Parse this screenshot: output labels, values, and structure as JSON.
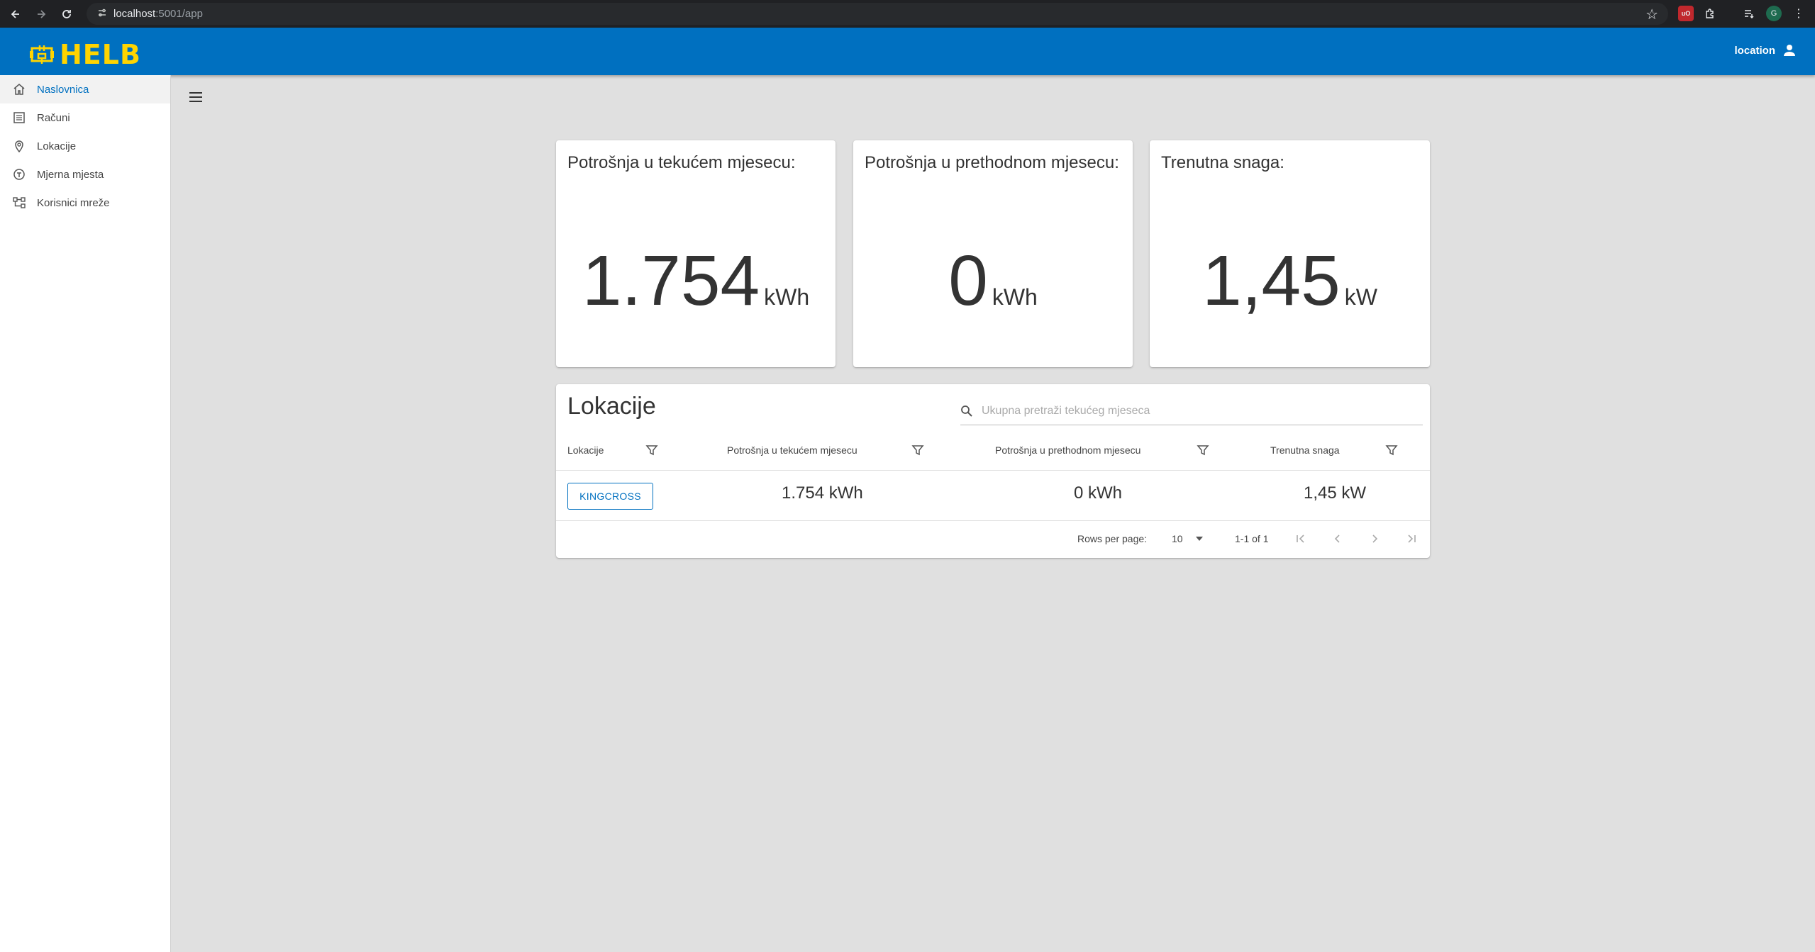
{
  "browser": {
    "url_host": "localhost",
    "url_path": ":5001/app"
  },
  "app": {
    "logo_text": "HELB",
    "user_label": "location"
  },
  "sidebar": {
    "items": [
      {
        "label": "Naslovnica",
        "icon": "home-icon"
      },
      {
        "label": "Računi",
        "icon": "list-icon"
      },
      {
        "label": "Lokacije",
        "icon": "location-pin-icon"
      },
      {
        "label": "Mjerna mjesta",
        "icon": "meter-icon"
      },
      {
        "label": "Korisnici mreže",
        "icon": "network-icon"
      }
    ]
  },
  "stats": [
    {
      "title": "Potrošnja u tekućem mjesecu:",
      "value": "1.754",
      "unit": "kWh"
    },
    {
      "title": "Potrošnja u prethodnom mjesecu:",
      "value": "0",
      "unit": "kWh"
    },
    {
      "title": "Trenutna snaga:",
      "value": "1,45",
      "unit": "kW"
    }
  ],
  "table": {
    "title": "Lokacije",
    "search_placeholder": "Ukupna pretraži tekućeg mjeseca",
    "columns": [
      "Lokacije",
      "Potrošnja u tekućem mjesecu",
      "Potrošnja u prethodnom mjesecu",
      "Trenutna snaga"
    ],
    "rows": [
      {
        "location": "KINGCROSS",
        "current": "1.754 kWh",
        "previous": "0 kWh",
        "power": "1,45 kW"
      }
    ],
    "pagination": {
      "rows_per_page_label": "Rows per page:",
      "rows_per_page_value": "10",
      "range": "1-1 of 1"
    }
  },
  "colors": {
    "appbar": "#0070c0",
    "logo": "#ffd400",
    "accent": "#0070c0"
  }
}
